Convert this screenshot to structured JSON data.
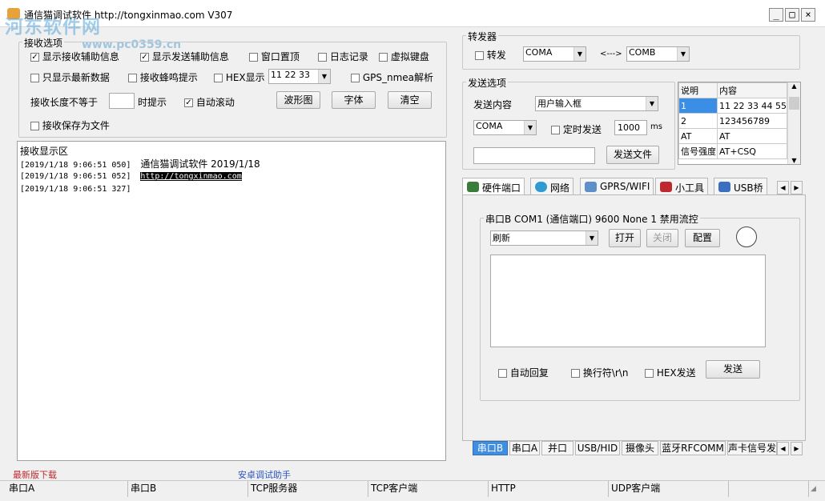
{
  "window": {
    "title": "通信猫调试软件  http://tongxinmao.com   V307",
    "minimize": "_",
    "maximize": "□",
    "close": "×"
  },
  "watermark": {
    "line1": "河东软件网",
    "line2": "www.pc0359.cn"
  },
  "recv_options": {
    "title": "接收选项",
    "show_recv_info": "显示接收辅助信息",
    "show_send_info": "显示发送辅助信息",
    "window_top": "窗口置顶",
    "log": "日志记录",
    "virtual_keyboard": "虚拟键盘",
    "only_latest": "只显示最新数据",
    "beep": "接收蜂鸣提示",
    "hex_display": "HEX显示",
    "hex_sample": "11 22 33",
    "gps_nmea": "GPS_nmea解析",
    "length_prefix": "接收长度不等于",
    "length_suffix": "时提示",
    "auto_scroll": "自动滚动",
    "waveform_btn": "波形图",
    "font_btn": "字体",
    "clear_btn": "清空",
    "save_to_file": "接收保存为文件"
  },
  "recv_area": {
    "title": "接收显示区",
    "lines": [
      {
        "ts": "[2019/1/18 9:06:51 050]",
        "text": "通信猫调试软件    2019/1/18"
      },
      {
        "ts": "[2019/1/18 9:06:51 052]",
        "text": "http://tongxinmao.com"
      },
      {
        "ts": "[2019/1/18 9:06:51 327]",
        "text": ""
      }
    ]
  },
  "bottom_links": {
    "download": "最新版下载",
    "android": "安卓调试助手"
  },
  "forwarder": {
    "title": "转发器",
    "forward": "转发",
    "port_a": "COMA",
    "arrow": "<--->",
    "port_b": "COMB"
  },
  "send_options": {
    "title": "发送选项",
    "content_label": "发送内容",
    "content_mode": "用户输入框",
    "port": "COMA",
    "timed_send": "定时发送",
    "interval": "1000",
    "unit": "ms",
    "send_file_btn": "发送文件",
    "table_headers": [
      "说明",
      "内容"
    ],
    "table_rows": [
      [
        "1",
        "11 22 33 44 55"
      ],
      [
        "2",
        "123456789"
      ],
      [
        "AT",
        "AT"
      ],
      [
        "信号强度",
        "AT+CSQ"
      ]
    ]
  },
  "tabs": [
    {
      "label": "硬件端口",
      "icon": "hardware-port-icon",
      "color": "#3a7d3a"
    },
    {
      "label": "网络",
      "icon": "network-icon",
      "color": "#2f9bd0"
    },
    {
      "label": "GPRS/WIFI",
      "icon": "gprs-wifi-icon",
      "color": "#5f8fc9"
    },
    {
      "label": "小工具",
      "icon": "tools-icon",
      "color": "#c0282f"
    },
    {
      "label": "USB桥",
      "icon": "usb-bridge-icon",
      "color": "#3c6fbf"
    }
  ],
  "serial_panel": {
    "title": "串口B COM1 (通信端口) 9600  None  1 禁用流控",
    "port_select": "刷新",
    "open_btn": "打开",
    "close_btn": "关闭",
    "config_btn": "配置",
    "auto_reply": "自动回复",
    "newline": "换行符\\r\\n",
    "hex_send": "HEX发送",
    "send_btn": "发送"
  },
  "bottom_tabs": [
    "串口B",
    "串口A",
    "并口",
    "USB/HID",
    "摄像头",
    "蓝牙RFCOMM",
    "声卡信号发"
  ],
  "status_bar": [
    "串口A",
    "串口B",
    "TCP服务器",
    "TCP客户端",
    "HTTP",
    "UDP客户端"
  ]
}
